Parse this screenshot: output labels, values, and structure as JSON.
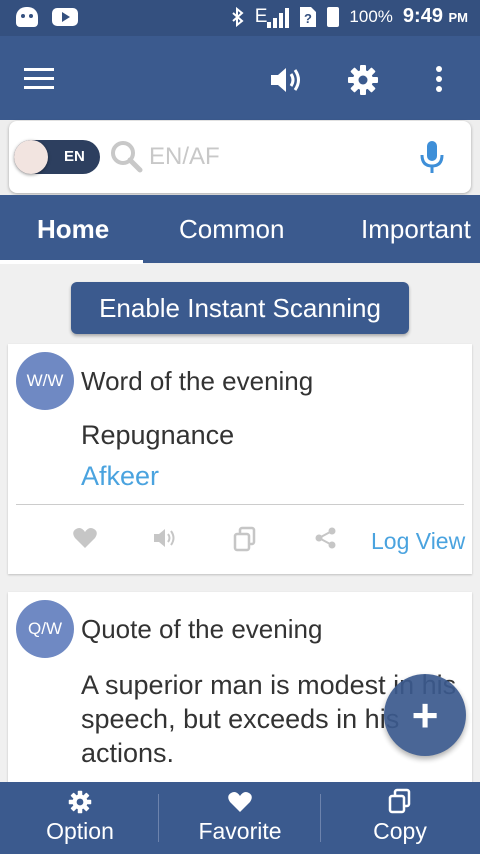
{
  "status_bar": {
    "network": "E",
    "battery": "100%",
    "time": "9:49",
    "ampm": "PM"
  },
  "search": {
    "toggle_label": "EN",
    "placeholder": "EN/AF"
  },
  "tabs": [
    {
      "label": "Home",
      "active": true
    },
    {
      "label": "Common",
      "active": false
    },
    {
      "label": "Important",
      "active": false
    }
  ],
  "scan_button": "Enable Instant Scanning",
  "word_card": {
    "avatar": "W/W",
    "title": "Word of the evening",
    "word": "Repugnance",
    "meaning": "Afkeer",
    "log_view": "Log View"
  },
  "quote_card": {
    "avatar": "Q/W",
    "title": "Quote of the evening",
    "quote": "A superior man is modest in his speech, but exceeds in his actions."
  },
  "fab": "+",
  "bottom_bar": [
    {
      "label": "Option",
      "icon": "gear-icon"
    },
    {
      "label": "Favorite",
      "icon": "heart-icon"
    },
    {
      "label": "Copy",
      "icon": "copy-icon"
    }
  ],
  "colors": {
    "primary": "#3b5a8e",
    "status_bar": "#34507f",
    "accent_link": "#4aa3df",
    "avatar": "#6f89c3"
  }
}
